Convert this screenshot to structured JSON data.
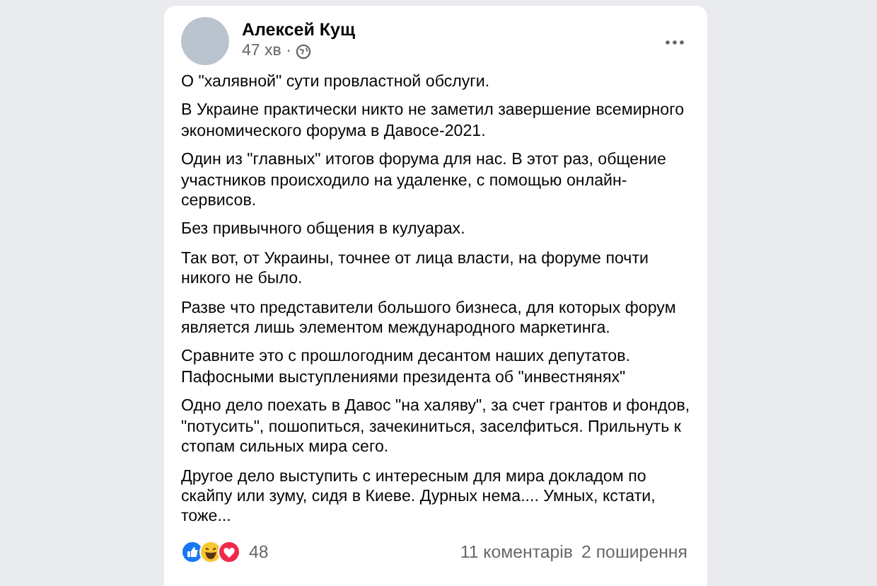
{
  "post": {
    "author": "Алексей Кущ",
    "time": "47 хв",
    "time_separator": "·",
    "paragraphs": [
      "О \"халявной\" сути провластной обслуги.",
      "В Украине практически никто не заметил завершение всемирного экономического форума в Давосе-2021.",
      "Один из \"главных\" итогов форума для нас. В этот раз, общение участников происходило на удаленке, с помощью онлайн-сервисов.",
      "Без привычного общения в кулуарах.",
      "Так вот, от Украины, точнее от лица власти, на форуме почти никого не было.",
      "Разве что представители большого бизнеса, для которых форум является лишь элементом международного маркетинга.",
      "Сравните это с прошлогодним десантом наших депутатов. Пафосными выступлениями президента об \"инвестнянях\"",
      "Одно дело поехать в Давос \"на халяву\", за счет грантов и фондов, \"потусить\", пошопиться, зачекиниться, заселфиться. Прильнуть к стопам сильных мира сего.",
      "Другое дело выступить с интересным для мира докладом по скайпу или зуму, сидя в Киеве. Дурных нема.... Умных, кстати, тоже..."
    ],
    "reactions_count": "48",
    "comments": "11 коментарів",
    "shares": "2 поширення"
  }
}
